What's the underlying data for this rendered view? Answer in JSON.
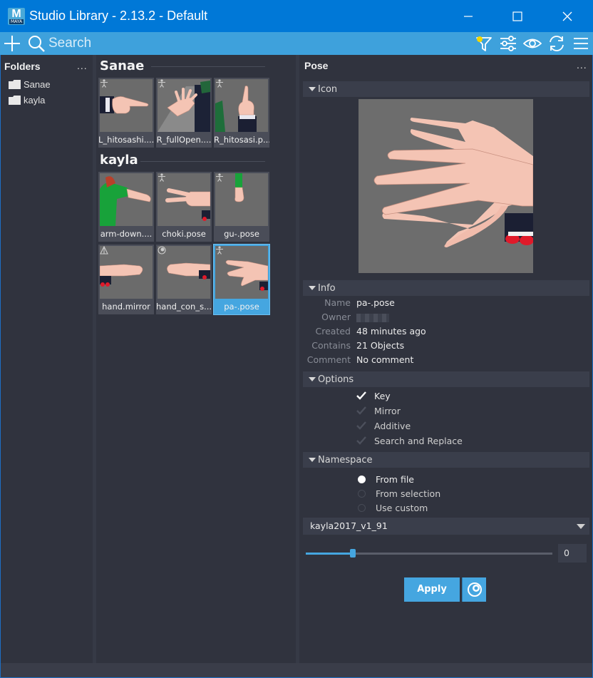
{
  "window": {
    "title": "Studio Library - 2.13.2 - Default",
    "app_icon": {
      "letter": "M",
      "sub": "MAYA"
    },
    "controls": [
      "minimize-icon",
      "maximize-icon",
      "close-icon"
    ]
  },
  "toolbar": {
    "search_placeholder": "Search",
    "icons": [
      "add-icon",
      "search-icon",
      "filter-icon",
      "sliders-icon",
      "eye-icon",
      "sync-icon",
      "menu-icon"
    ],
    "filter_dot_color": "#f2d600"
  },
  "sidebar": {
    "title": "Folders",
    "more": "...",
    "folders": [
      {
        "label": "Sanae"
      },
      {
        "label": "kayla"
      }
    ]
  },
  "library": {
    "groups": [
      {
        "title": "Sanae",
        "items": [
          {
            "caption": "L_hitosashi....",
            "badge": "figure-icon",
            "thumb": "point"
          },
          {
            "caption": "R_fullOpen....",
            "badge": "figure-icon",
            "thumb": "openhand"
          },
          {
            "caption": "R_hitosasi.p...",
            "badge": "figure-icon",
            "thumb": "finger-up"
          }
        ]
      },
      {
        "title": "kayla",
        "items": [
          {
            "caption": "arm-down....",
            "badge": "none",
            "thumb": "arm"
          },
          {
            "caption": "choki.pose",
            "badge": "figure-icon",
            "thumb": "peace"
          },
          {
            "caption": "gu-.pose",
            "badge": "figure-icon",
            "thumb": "fist"
          },
          {
            "caption": "hand.mirror",
            "badge": "mirror-icon",
            "thumb": "flat-left"
          },
          {
            "caption": "hand_con_s...",
            "badge": "selection-icon",
            "thumb": "flat-right"
          },
          {
            "caption": "pa-.pose",
            "badge": "figure-icon",
            "thumb": "spread",
            "selected": true
          }
        ]
      }
    ]
  },
  "details": {
    "title": "Pose",
    "more": "...",
    "icon_section": "Icon",
    "info_section": "Info",
    "info": [
      {
        "label": "Name",
        "value": "pa-.pose"
      },
      {
        "label": "Owner",
        "value": ""
      },
      {
        "label": "Created",
        "value": "48 minutes ago"
      },
      {
        "label": "Contains",
        "value": "21 Objects"
      },
      {
        "label": "Comment",
        "value": "No comment"
      }
    ],
    "options_section": "Options",
    "options": [
      {
        "label": "Key",
        "checked": true
      },
      {
        "label": "Mirror",
        "checked": false
      },
      {
        "label": "Additive",
        "checked": false
      },
      {
        "label": "Search and Replace",
        "checked": false
      }
    ],
    "namespace_section": "Namespace",
    "namespace_options": [
      {
        "label": "From file",
        "selected": true
      },
      {
        "label": "From selection",
        "selected": false
      },
      {
        "label": "Use custom",
        "selected": false
      }
    ],
    "namespace_value": "kayla2017_v1_91",
    "slider_value": "0",
    "slider_fraction": 0.19,
    "apply_label": "Apply"
  },
  "colors": {
    "titlebar": "#0078d7",
    "toolbar": "#3ea1dc",
    "accent": "#45a6e0",
    "panel": "#30333e",
    "section": "#3a3e4b"
  }
}
